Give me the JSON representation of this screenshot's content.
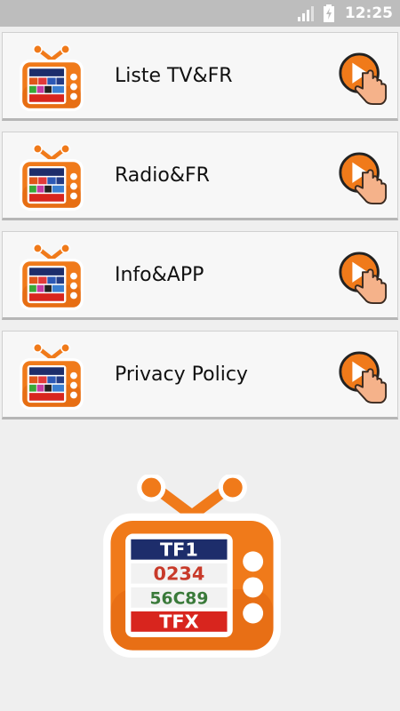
{
  "status_bar": {
    "time": "12:25"
  },
  "menu": [
    {
      "label": "Liste TV&FR"
    },
    {
      "label": "Radio&FR"
    },
    {
      "label": "Info&APP"
    },
    {
      "label": "Privacy Policy"
    }
  ],
  "logo": {
    "rows": [
      "TF1",
      "0234",
      "56C89",
      "TFX"
    ]
  },
  "colors": {
    "accent": "#f07a1a",
    "accent_dark": "#d85e10",
    "status_bar": "#bdbdbd",
    "background": "#efefef"
  }
}
